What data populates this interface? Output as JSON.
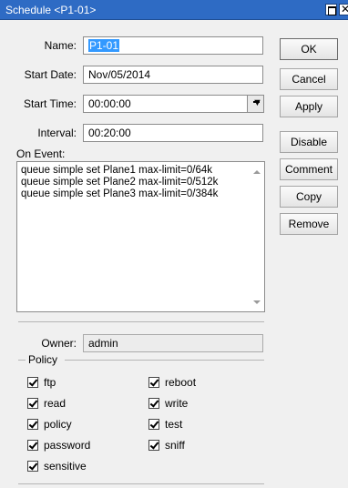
{
  "window": {
    "title": "Schedule <P1-01>"
  },
  "form": {
    "name_label": "Name:",
    "name_value": "P1-01",
    "start_date_label": "Start Date:",
    "start_date_value": "Nov/05/2014",
    "start_time_label": "Start Time:",
    "start_time_value": "00:00:00",
    "interval_label": "Interval:",
    "interval_value": "00:20:00",
    "on_event_label": "On Event:",
    "on_event_lines": [
      "queue simple set Plane1 max-limit=0/64k",
      "queue simple set Plane2 max-limit=0/512k",
      "queue simple set Plane3 max-limit=0/384k"
    ],
    "owner_label": "Owner:",
    "owner_value": "admin"
  },
  "buttons": {
    "ok": "OK",
    "cancel": "Cancel",
    "apply": "Apply",
    "disable": "Disable",
    "comment": "Comment",
    "copy": "Copy",
    "remove": "Remove"
  },
  "policy": {
    "legend": "Policy",
    "items": [
      {
        "label": "ftp",
        "checked": true
      },
      {
        "label": "reboot",
        "checked": true
      },
      {
        "label": "read",
        "checked": true
      },
      {
        "label": "write",
        "checked": true
      },
      {
        "label": "policy",
        "checked": true
      },
      {
        "label": "test",
        "checked": true
      },
      {
        "label": "password",
        "checked": true
      },
      {
        "label": "sniff",
        "checked": true
      },
      {
        "label": "sensitive",
        "checked": true
      }
    ]
  },
  "colors": {
    "titlebar": "#2e6bc4",
    "selection": "#3399ff",
    "window_bg": "#f0f0f0"
  }
}
